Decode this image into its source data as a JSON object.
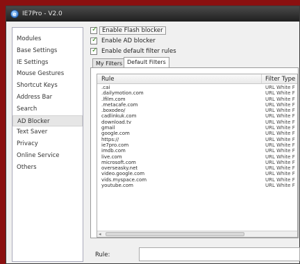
{
  "window": {
    "title": "IE7Pro - V2.0",
    "icon_glyph": "e"
  },
  "sidebar": {
    "items": [
      {
        "label": "Modules"
      },
      {
        "label": "Base Settings"
      },
      {
        "label": "IE Settings"
      },
      {
        "label": "Mouse Gestures"
      },
      {
        "label": "Shortcut Keys"
      },
      {
        "label": "Address Bar"
      },
      {
        "label": "Search"
      },
      {
        "label": "AD Blocker"
      },
      {
        "label": "Text Saver"
      },
      {
        "label": "Privacy"
      },
      {
        "label": "Online Service"
      },
      {
        "label": "Others"
      }
    ],
    "selected": "AD Blocker"
  },
  "options": {
    "flash_blocker": {
      "label": "Enable Flash blocker",
      "checked": true
    },
    "ad_blocker": {
      "label": "Enable AD blocker",
      "checked": true
    },
    "default_filter": {
      "label": "Enable default filter rules",
      "checked": true
    }
  },
  "tabs": {
    "my_filters": "My Filters",
    "default_filters": "Default Filters",
    "active": "Default Filters"
  },
  "list": {
    "headers": {
      "rule": "Rule",
      "filter_type": "Filter Type"
    },
    "rows": [
      {
        "rule": ".cai",
        "type": "URL White F"
      },
      {
        "rule": ".dailymotion.com",
        "type": "URL White F"
      },
      {
        "rule": ".lfilm.com",
        "type": "URL White F"
      },
      {
        "rule": ".metacafe.com",
        "type": "URL White F"
      },
      {
        "rule": ".boxodeo/",
        "type": "URL White F"
      },
      {
        "rule": "cadlinkuk.com",
        "type": "URL White F"
      },
      {
        "rule": "download.tv",
        "type": "URL White F"
      },
      {
        "rule": "gmail",
        "type": "URL White F"
      },
      {
        "rule": "google.com",
        "type": "URL White F"
      },
      {
        "rule": "https://",
        "type": "URL White F"
      },
      {
        "rule": "ie7pro.com",
        "type": "URL White F"
      },
      {
        "rule": "imdb.com",
        "type": "URL White F"
      },
      {
        "rule": "live.com",
        "type": "URL White F"
      },
      {
        "rule": "microsoft.com",
        "type": "URL White F"
      },
      {
        "rule": "overseasky.net",
        "type": "URL White F"
      },
      {
        "rule": "video.google.com",
        "type": "URL White F"
      },
      {
        "rule": "vids.myspace.com",
        "type": "URL White F"
      },
      {
        "rule": "youtube.com",
        "type": "URL White F"
      }
    ]
  },
  "rule_field": {
    "label": "Rule:",
    "value": ""
  }
}
